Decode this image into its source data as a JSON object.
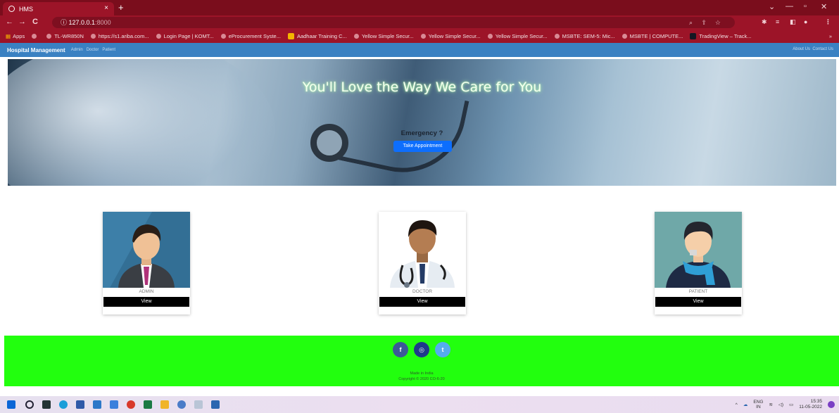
{
  "browser": {
    "tab_title": "HMS",
    "tab_close": "×",
    "new_tab": "+",
    "back": "←",
    "forward": "→",
    "reload": "C",
    "url_host": "127.0.0.1",
    "url_rest": ":8000",
    "window_min": "—",
    "window_max": "▫",
    "window_close": "✕",
    "window_chevron": "⌄",
    "menu_dots": "⋮",
    "bookmarks": [
      "Apps",
      "TL-WR850N",
      "https://s1.ariba.com...",
      "Login Page | KOMT...",
      "eProcurement Syste...",
      "Aadhaar Training C...",
      "Yellow Simple Secur...",
      "Yellow Simple Secur...",
      "Yellow Simple Secur...",
      "MSBTE: SEM-5: Mic...",
      "MSBTE | COMPUTE...",
      "TradingView – Track..."
    ],
    "bookmarks_more": "»"
  },
  "navbar": {
    "brand": "Hospital Management",
    "links": [
      "Admin",
      "Doctor",
      "Patient"
    ],
    "about": "About Us",
    "contact": "Contact Us"
  },
  "hero": {
    "title": "You'll Love the Way We Care for You",
    "emergency": "Emergency ?",
    "button": "Take Appointment"
  },
  "cards": [
    {
      "label": "ADMIN",
      "button": "View"
    },
    {
      "label": "DOCTOR",
      "button": "View"
    },
    {
      "label": "PATIENT",
      "button": "View"
    }
  ],
  "footer": {
    "social": [
      "f",
      "◎",
      "t"
    ],
    "social_colors": [
      "#3b5998",
      "#1e3a8a",
      "#55acee"
    ],
    "made_in": "Made in India",
    "copyright": "Copyright © 2020 CO-6-20"
  },
  "taskbar": {
    "lang": "ENG",
    "region": "IN",
    "time": "15:35",
    "date": "11-05-2022",
    "chevron": "^"
  },
  "colors": {
    "tabbar": "#7a0d1c",
    "chrome": "#9c1428",
    "navbar": "#3a81c2",
    "footer": "#22ff0e",
    "primary_button": "#0d6efd"
  }
}
